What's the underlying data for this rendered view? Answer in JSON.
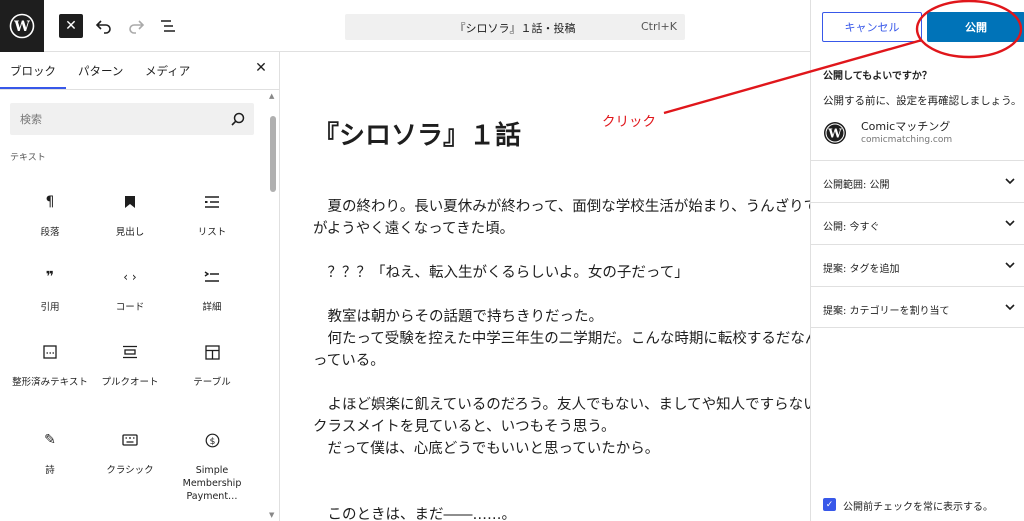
{
  "topbar": {
    "doc_title": "『シロソラ』１話・投稿",
    "shortcut": "Ctrl+K",
    "close_glyph": "✕"
  },
  "inserter": {
    "tabs": [
      {
        "label": "ブロック"
      },
      {
        "label": "パターン"
      },
      {
        "label": "メディア"
      }
    ],
    "close_glyph": "✕",
    "search_placeholder": "検索",
    "section_label": "テキスト",
    "blocks": [
      {
        "label": "段落",
        "icon": "paragraph-icon"
      },
      {
        "label": "見出し",
        "icon": "heading-icon"
      },
      {
        "label": "リスト",
        "icon": "list-icon"
      },
      {
        "label": "引用",
        "icon": "quote-icon"
      },
      {
        "label": "コード",
        "icon": "code-icon"
      },
      {
        "label": "詳細",
        "icon": "details-icon"
      },
      {
        "label": "整形済みテキスト",
        "icon": "preformatted-icon"
      },
      {
        "label": "プルクオート",
        "icon": "pullquote-icon"
      },
      {
        "label": "テーブル",
        "icon": "table-icon"
      },
      {
        "label": "詩",
        "icon": "verse-icon"
      },
      {
        "label": "クラシック",
        "icon": "classic-icon"
      },
      {
        "label": "Simple Membership Payment…",
        "icon": "payment-icon"
      }
    ]
  },
  "editor": {
    "title": "『シロソラ』１話",
    "lines": [
      "　夏の終わり。長い夏休みが終わって、面倒な学校生活が始まり、うんざりて",
      "がようやく遠くなってきた頃。",
      "　？？？「ねえ、転入生がくるらしいよ。女の子だって」",
      "　教室は朝からその話題で持ちきりだった。",
      "　何たって受験を控えた中学三年生の二学期だ。こんな時期に転校するだなん",
      "っている。",
      "　よほど娯楽に飢えているのだろう。友人でもない、ましてや知人ですらない",
      "クラスメイトを見ていると、いつもそう思う。",
      "　だって僕は、心底どうでもいいと思っていたから。",
      "　このときは、まだ――……。"
    ]
  },
  "annotation": {
    "label": "クリック",
    "color": "#e0161b"
  },
  "panel": {
    "cancel_label": "キャンセル",
    "publish_label": "公開",
    "question": "公開してもよいですか？",
    "note": "公開する前に、設定を再確認しましょう。",
    "site_name": "Comicマッチング",
    "site_url": "comicmatching.com",
    "rows": [
      {
        "label": "公開範囲: 公開"
      },
      {
        "label": "公開: 今すぐ"
      },
      {
        "label": "提案: タグを追加"
      },
      {
        "label": "提案: カテゴリーを割り当て"
      }
    ],
    "checkbox_label": "公開前チェックを常に表示する。",
    "checkbox_checked": true
  },
  "colors": {
    "accent": "#3858e9",
    "publish": "#0073b8",
    "dark": "#1e1e1e"
  }
}
